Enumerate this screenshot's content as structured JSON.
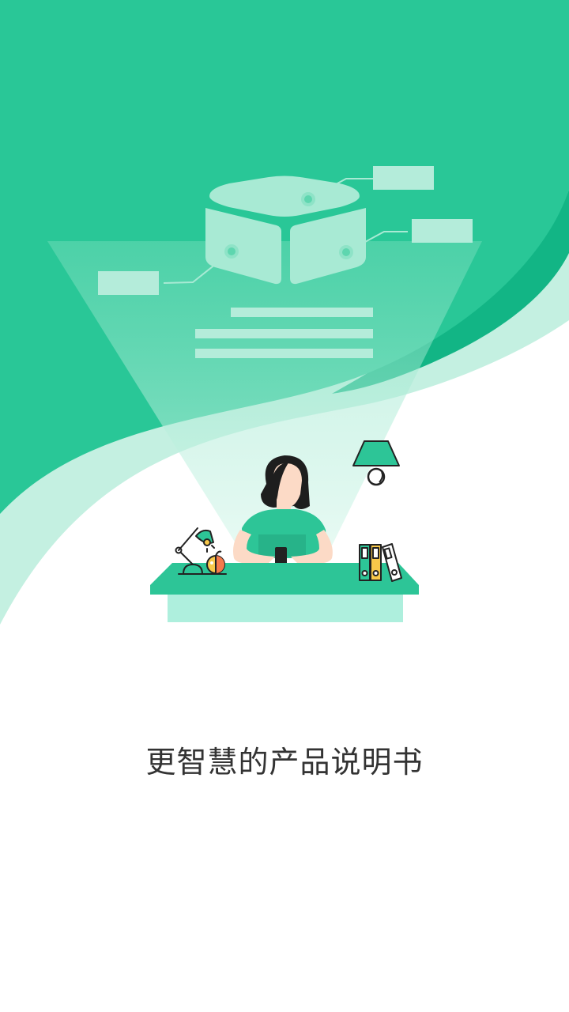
{
  "splash": {
    "tagline": "更智慧的产品说明书"
  },
  "colors": {
    "brand_green": "#29C797",
    "brand_green_dark": "#12B585",
    "mint_light": "#AEEAD6",
    "desk_top": "#2DC597"
  },
  "illustration": {
    "scene": "woman-at-desk-with-floating-book-hologram",
    "icons": [
      "open-book-icon",
      "desk-lamp-icon",
      "apple-icon",
      "binders-icon",
      "hanging-lamp-icon",
      "phone-icon"
    ]
  }
}
